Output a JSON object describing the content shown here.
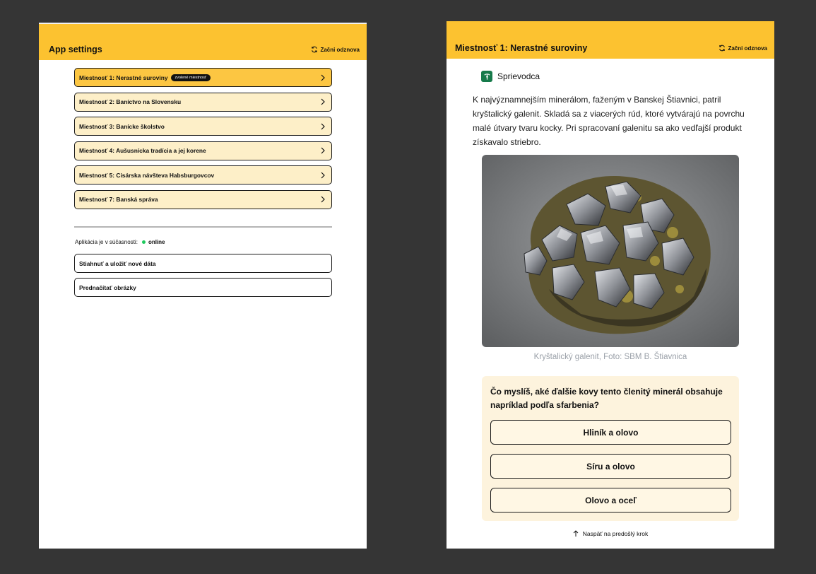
{
  "left_screen": {
    "header": {
      "title": "App settings",
      "restart_label": "Začni odznova"
    },
    "rooms": [
      {
        "label": "Miestnosť 1: Nerastné suroviny",
        "badge": "zvolené miestnosť",
        "active": true
      },
      {
        "label": "Miestnosť 2: Baníctvo na Slovensku",
        "badge": "",
        "active": false
      },
      {
        "label": "Miestnosť 3: Banícke školstvo",
        "badge": "",
        "active": false
      },
      {
        "label": "Miestnosť 4: Aušusnícka tradícia a jej korene",
        "badge": "",
        "active": false
      },
      {
        "label": "Miestnosť 5: Cisárska návšteva Habsburgovcov",
        "badge": "",
        "active": false
      },
      {
        "label": "Miestnosť 7: Banská správa",
        "badge": "",
        "active": false
      }
    ],
    "status": {
      "label": "Aplikácia je v súčasnosti:",
      "value": "online",
      "dot_color": "#1ec95d"
    },
    "actions": {
      "download_label": "Stiahnuť a uložiť nové dáta",
      "preload_label": "Prednačítať obrázky"
    }
  },
  "right_screen": {
    "header": {
      "title": "Miestnosť 1: Nerastné suroviny",
      "restart_label": "Začni odznova"
    },
    "guide_label": "Sprievodca",
    "paragraph": "K najvýznamnejším minerálom, faženým v Banskej Štiavnici, patril kryštalický galenit. Skladá sa z viacerých rúd, ktoré vytvárajú na povrchu malé útvary tvaru kocky. Pri spracovaní galenitu sa ako vedľajší produkt získavalo striebro.",
    "photo_caption": "Kryštalický galenit, Foto: SBM B. Štiavnica",
    "quiz": {
      "question": "Čo myslíš, aké ďalšie kovy tento členitý minerál obsahuje napríklad podľa sfarbenia?",
      "answers": [
        "Hliník a olovo",
        "Síru a olovo",
        "Olovo a oceľ"
      ]
    },
    "back_label": "Naspäť na predošlý krok"
  },
  "colors": {
    "accent": "#fcc230",
    "room_bg": "#fdefc8",
    "quiz_bg": "#fdf3dd",
    "app_bg": "#353535"
  }
}
